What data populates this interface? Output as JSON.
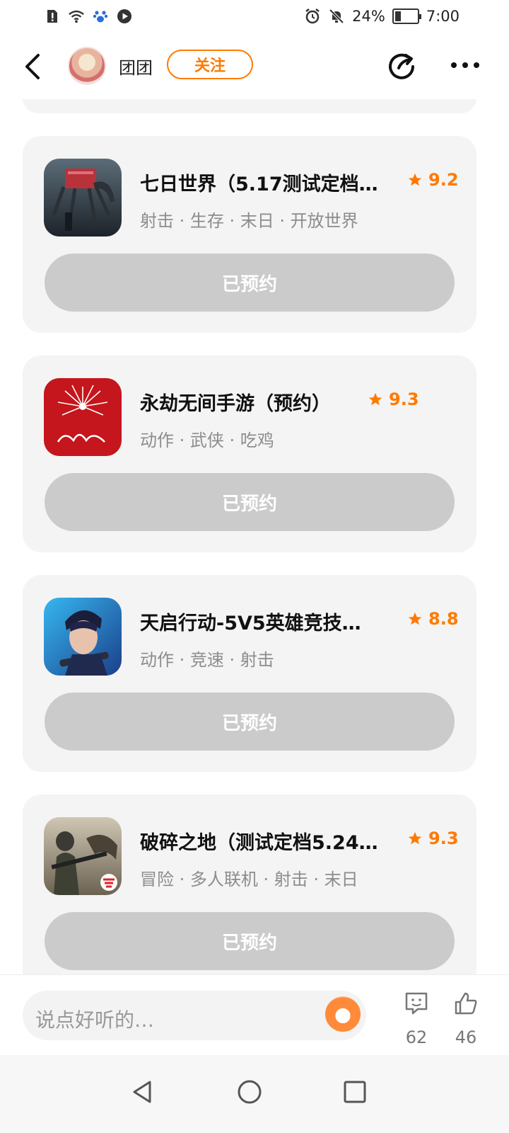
{
  "status_bar": {
    "battery": "24%",
    "time": "7:00"
  },
  "header": {
    "username": "团团",
    "follow_label": "关注"
  },
  "cards": [
    {
      "title": "七日世界（5.17测试定档…",
      "rating": "9.2",
      "tags": "射击 · 生存 · 末日 · 开放世界",
      "button": "已预约",
      "icon": "seven-days-world-icon"
    },
    {
      "title": "永劫无间手游（预约）",
      "rating": "9.3",
      "tags": "动作 · 武侠 · 吃鸡",
      "button": "已预约",
      "icon": "naraka-mobile-icon"
    },
    {
      "title": "天启行动-5V5英雄竞技…",
      "rating": "8.8",
      "tags": "动作 · 竞速 · 射击",
      "button": "已预约",
      "icon": "tianqi-xingdong-icon"
    },
    {
      "title": "破碎之地（测试定档5.24…",
      "rating": "9.3",
      "tags": "冒险 · 多人联机 · 射击 · 末日",
      "button": "已预约",
      "icon": "broken-land-icon"
    }
  ],
  "bottom_bar": {
    "comment_placeholder": "说点好听的…",
    "comment_count": "62",
    "like_count": "46"
  },
  "colors": {
    "accent": "#ff7a00",
    "card_bg": "#f4f4f4",
    "button_disabled": "#cbcbcb"
  }
}
